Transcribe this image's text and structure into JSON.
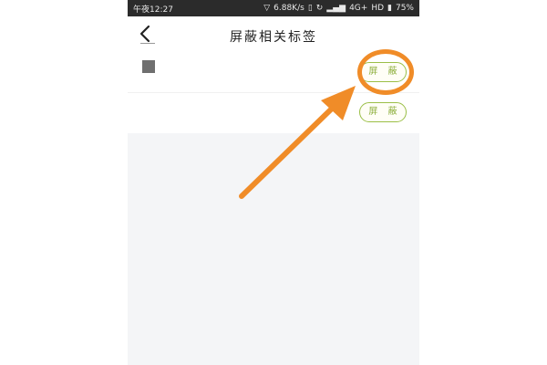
{
  "statusbar": {
    "time": "午夜12:27",
    "net_speed": "6.88K/s",
    "network": "4G+",
    "hd": "HD",
    "battery": "75%",
    "icons": [
      "signal-icon",
      "wifi-icon",
      "sync-icon",
      "battery-icon"
    ]
  },
  "header": {
    "title": "屏蔽相关标签"
  },
  "rows": [
    {
      "button_label": "屏 蔽"
    },
    {
      "button_label": "屏 蔽"
    }
  ],
  "colors": {
    "accent_green": "#8cae3a",
    "annotation_orange": "#f08c28",
    "background": "#f4f5f7"
  }
}
